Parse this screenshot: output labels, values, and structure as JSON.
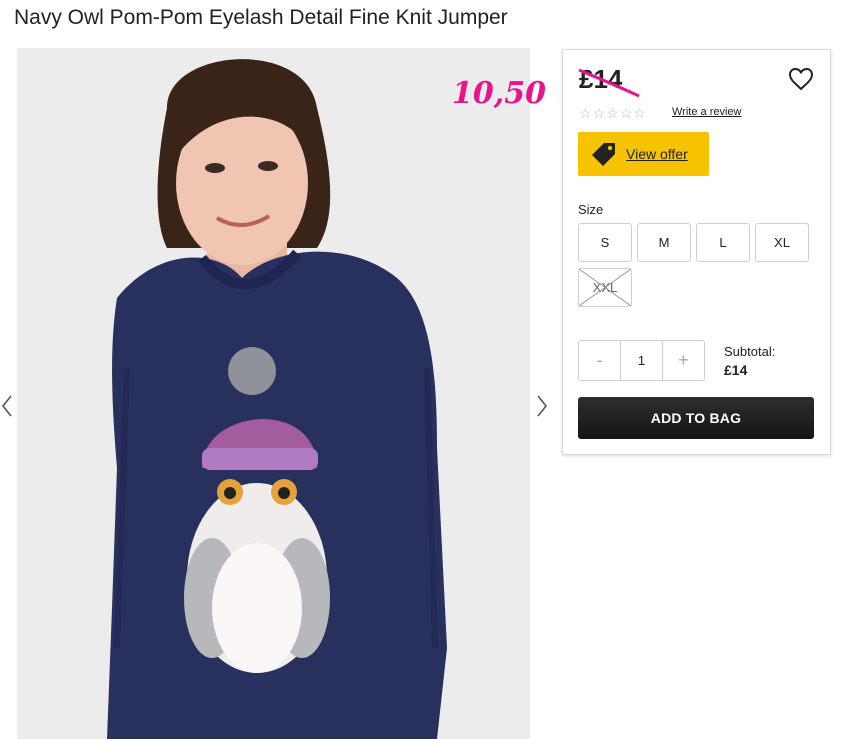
{
  "product": {
    "title": "Navy Owl Pom-Pom Eyelash Detail Fine Knit Jumper",
    "price": "£14",
    "sale_price_annotation": "10,50",
    "rating": {
      "stars": 0,
      "max": 5,
      "star_glyph": "☆"
    },
    "review_link": "Write a review",
    "offer_button": "View offer",
    "size_label": "Size",
    "sizes": [
      {
        "label": "S",
        "available": true
      },
      {
        "label": "M",
        "available": true
      },
      {
        "label": "L",
        "available": true
      },
      {
        "label": "XL",
        "available": true
      },
      {
        "label": "XXL",
        "available": false
      }
    ],
    "quantity": {
      "minus": "-",
      "value": "1",
      "plus": "+"
    },
    "subtotal_label": "Subtotal:",
    "subtotal_value": "£14",
    "add_to_bag": "ADD TO BAG"
  },
  "icons": {
    "wishlist": "heart-outline-icon",
    "offer": "price-tag-icon",
    "carousel_prev": "chevron-left-icon",
    "carousel_next": "chevron-right-icon"
  },
  "colors": {
    "annotation": "#e8158a",
    "offer_button": "#f7c200",
    "add_button": "#1f1f1f",
    "sweater": "#28305e"
  }
}
